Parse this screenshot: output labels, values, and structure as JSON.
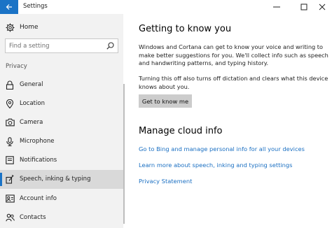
{
  "window": {
    "title": "Settings",
    "controls": {
      "minimize": "—",
      "maximize": "☐",
      "close": "✕"
    }
  },
  "sidebar": {
    "home_label": "Home",
    "search_placeholder": "Find a setting",
    "section": "Privacy",
    "items": [
      {
        "label": "General",
        "icon": "lock-icon"
      },
      {
        "label": "Location",
        "icon": "location-icon"
      },
      {
        "label": "Camera",
        "icon": "camera-icon"
      },
      {
        "label": "Microphone",
        "icon": "microphone-icon"
      },
      {
        "label": "Notifications",
        "icon": "notifications-icon"
      },
      {
        "label": "Speech, inking & typing",
        "icon": "pen-icon",
        "selected": true
      },
      {
        "label": "Account info",
        "icon": "account-icon"
      },
      {
        "label": "Contacts",
        "icon": "contacts-icon"
      }
    ]
  },
  "main": {
    "heading": "Getting to know you",
    "paragraph1": "Windows and Cortana can get to know your voice and writing to make better suggestions for you. We'll collect info such as speech and handwriting patterns, and typing history.",
    "paragraph2": "Turning this off also turns off dictation and clears what this device knows about you.",
    "button_label": "Get to know me",
    "cloud_heading": "Manage cloud info",
    "links": [
      "Go to Bing and manage personal info for all your devices",
      "Learn more about speech, inking and typing settings",
      "Privacy Statement"
    ]
  },
  "colors": {
    "accent": "#1a73c6",
    "link": "#1a6fc2",
    "sidebar_bg": "#f2f2f2",
    "selected_bg": "#d9d9d9"
  }
}
